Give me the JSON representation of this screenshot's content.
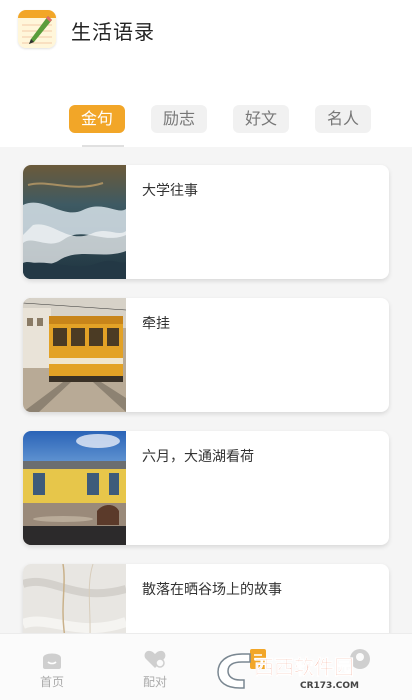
{
  "header": {
    "app_icon": "notebook-pencil-icon",
    "title": "生活语录"
  },
  "tabs": [
    {
      "label": "金句",
      "active": true
    },
    {
      "label": "励志",
      "active": false
    },
    {
      "label": "好文",
      "active": false
    },
    {
      "label": "名人",
      "active": false
    }
  ],
  "cards": [
    {
      "title": "大学往事",
      "thumb": "ocean-wave-photo"
    },
    {
      "title": "牵挂",
      "thumb": "yellow-tram-photo"
    },
    {
      "title": "六月，大通湖看荷",
      "thumb": "yellow-house-photo"
    },
    {
      "title": "散落在晒谷场上的故事",
      "thumb": "white-fabric-photo"
    }
  ],
  "bottom_nav": [
    {
      "label": "首页",
      "icon": "home-icon"
    },
    {
      "label": "配对",
      "icon": "heart-match-icon"
    },
    {
      "label": "",
      "icon": "notebook-icon"
    },
    {
      "label": "",
      "icon": "user-icon"
    }
  ],
  "watermark": {
    "brand": "西西软件园",
    "domain": "CR173.COM"
  },
  "colors": {
    "accent": "#f2a628",
    "list_background": "#f5f5f5"
  }
}
